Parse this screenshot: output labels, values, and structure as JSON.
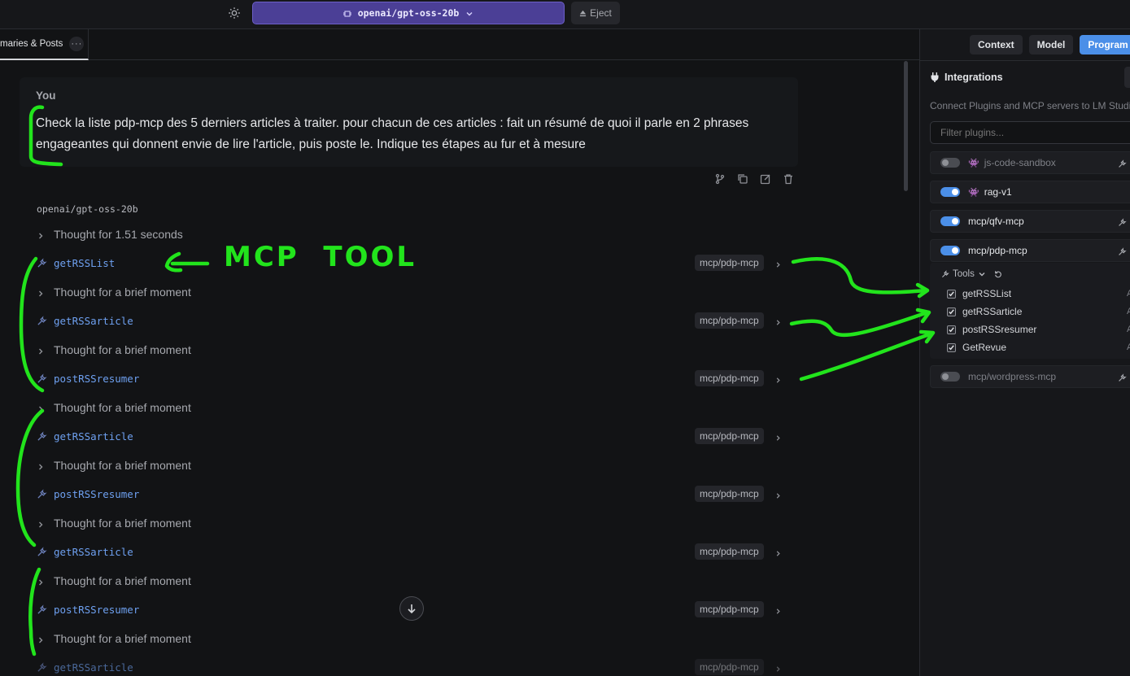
{
  "topbar": {
    "model": "openai/gpt-oss-20b",
    "eject_label": "Eject"
  },
  "tabstrip": {
    "tab_label": "maries & Posts",
    "tab_more": "···"
  },
  "chat": {
    "user": {
      "who": "You",
      "text": "Check la liste pdp-mcp des 5 derniers articles à traiter. pour chacun de ces articles : fait un résumé de quoi il parle en 2 phrases engageantes qui donnent envie de lire l'article, puis poste le. Indique tes étapes au fur et à mesure"
    },
    "assistant_name": "openai/gpt-oss-20b",
    "first_thought": "Thought for 1.51 seconds",
    "brief_thought": "Thought for a brief moment",
    "tool_badge": "mcp/pdp-mcp",
    "tools": [
      "getRSSList",
      "getRSSarticle",
      "postRSSresumer",
      "getRSSarticle",
      "postRSSresumer",
      "getRSSarticle",
      "postRSSresumer",
      "getRSSarticle"
    ]
  },
  "right_panel": {
    "tabs": [
      "Context",
      "Model",
      "Program"
    ],
    "active_tab": "Program",
    "title": "Integrations",
    "description": "Connect Plugins and MCP servers to LM Studio",
    "filter_placeholder": "Filter plugins...",
    "plugins": [
      {
        "name": "js-code-sandbox",
        "enabled": false,
        "icon": "alien-icon"
      },
      {
        "name": "rag-v1",
        "enabled": true,
        "icon": "alien-icon"
      },
      {
        "name": "mcp/qfv-mcp",
        "enabled": true,
        "icon": "wrench-icon"
      },
      {
        "name": "mcp/pdp-mcp",
        "enabled": true,
        "icon": "wrench-icon"
      },
      {
        "name": "mcp/wordpress-mcp",
        "enabled": false,
        "icon": "wrench-icon"
      }
    ],
    "tools_label": "Tools",
    "tool_list": [
      {
        "name": "getRSSList",
        "checked": true,
        "trail": "A"
      },
      {
        "name": "getRSSarticle",
        "checked": true,
        "trail": "A"
      },
      {
        "name": "postRSSresumer",
        "checked": true,
        "trail": "A"
      },
      {
        "name": "GetRevue",
        "checked": true,
        "trail": "A"
      }
    ]
  },
  "annotation": {
    "text": "MCP  TOOL",
    "color": "#22e41c"
  }
}
